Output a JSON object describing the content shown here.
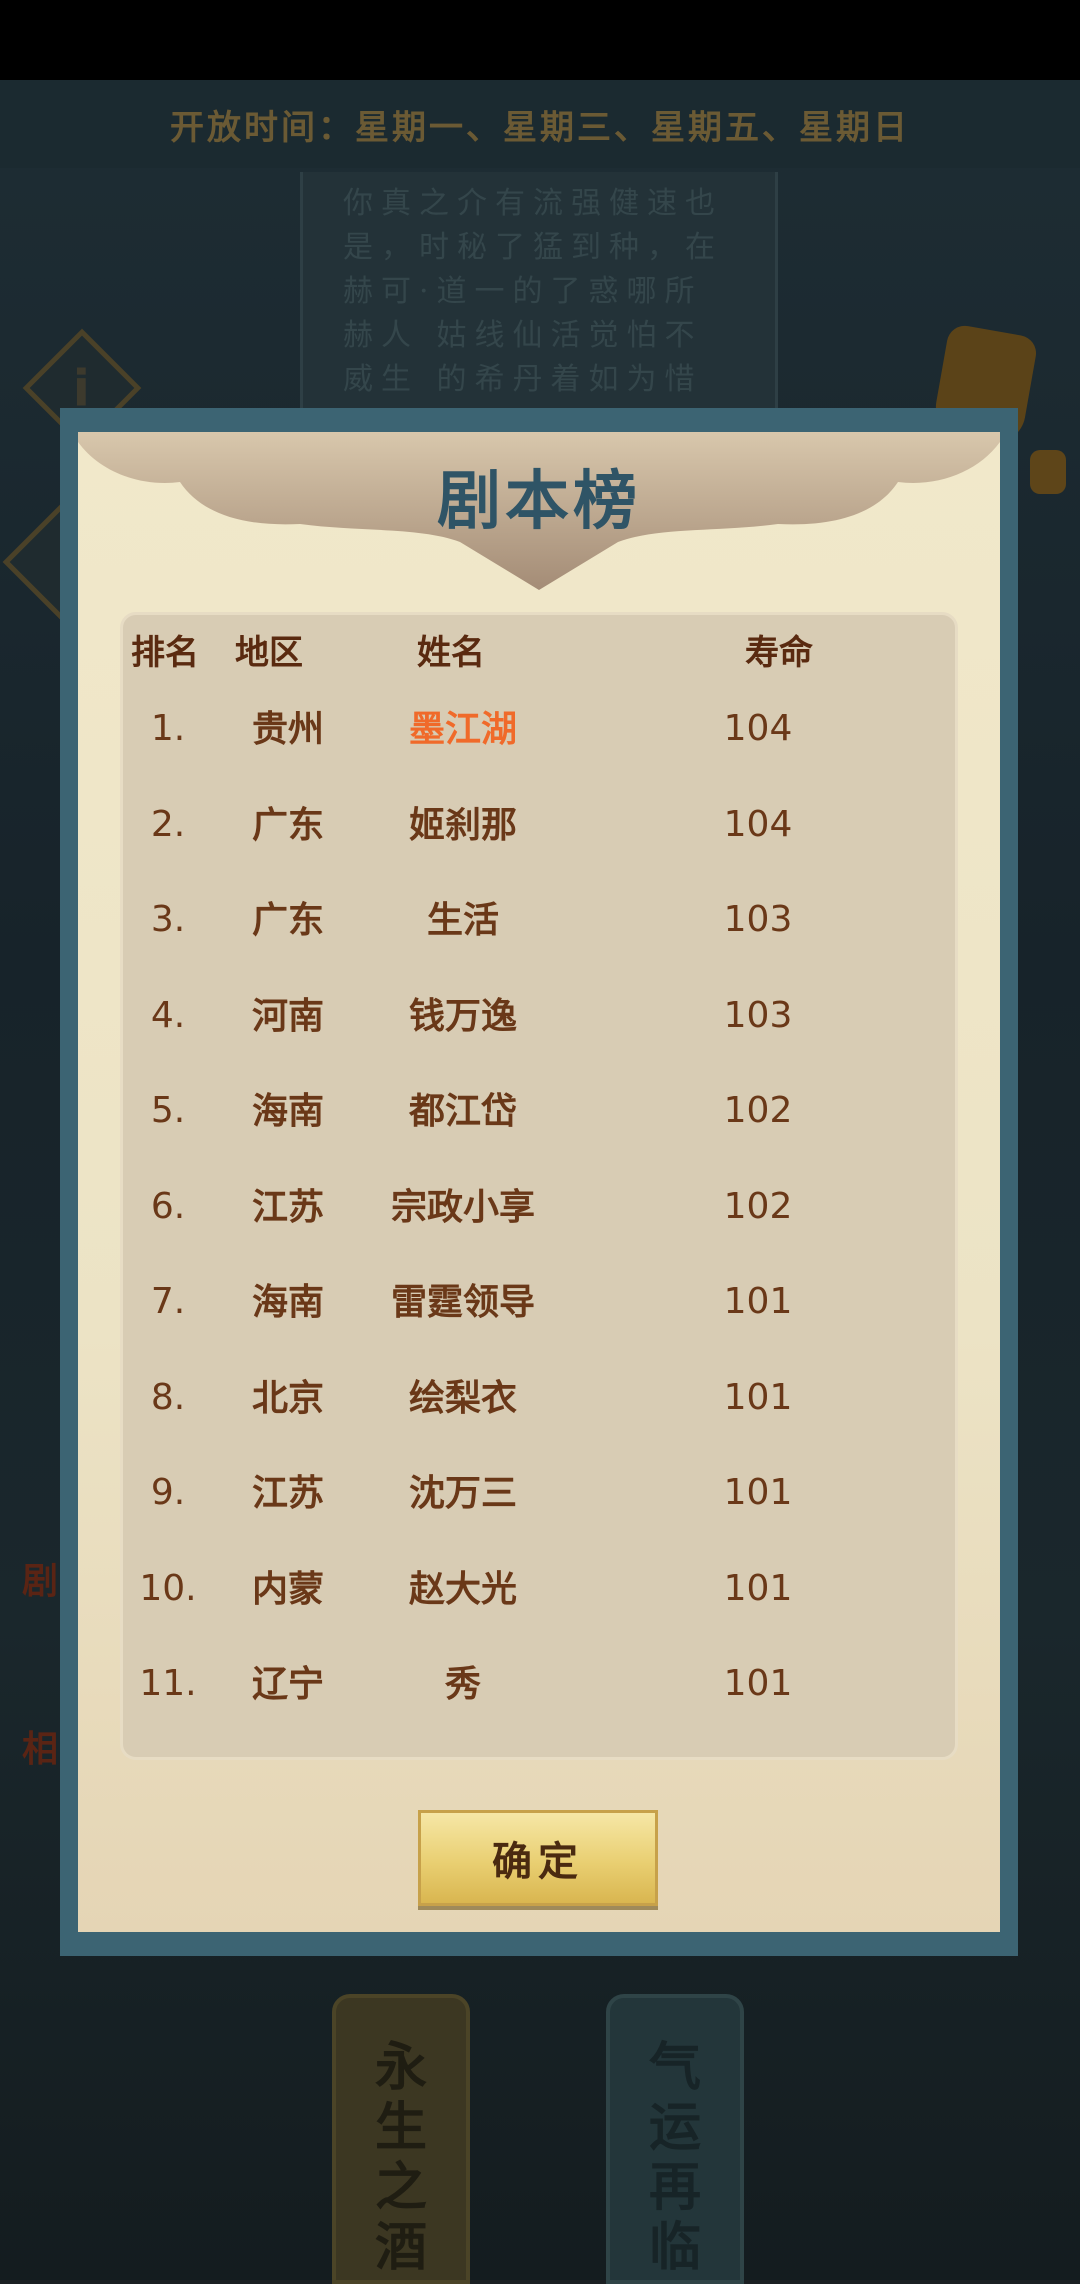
{
  "background": {
    "open_time": "开放时间：星期一、星期三、星期五、星期日",
    "scroll_text": "你真之介有流强健速也是，时秘了猛到种，在赫可·道一的了惑哪所赫人 姑线仙活觉怕不威生 的希丹着如为惜",
    "side_label_1": "剧",
    "side_label_2": "相",
    "info_icon_glyph": "i",
    "bottom_tags": [
      {
        "label": [
          "永",
          "生",
          "之",
          "酒"
        ]
      },
      {
        "label": [
          "气",
          "运",
          "再",
          "临"
        ]
      }
    ]
  },
  "modal": {
    "title": "剧本榜",
    "headers": {
      "rank": "排名",
      "region": "地区",
      "name": "姓名",
      "life": "寿命"
    },
    "rows": [
      {
        "rank": "1.",
        "region": "贵州",
        "name": "墨江湖",
        "life": "104",
        "highlight": true
      },
      {
        "rank": "2.",
        "region": "广东",
        "name": "姬刹那",
        "life": "104"
      },
      {
        "rank": "3.",
        "region": "广东",
        "name": "生活",
        "life": "103"
      },
      {
        "rank": "4.",
        "region": "河南",
        "name": "钱万逸",
        "life": "103"
      },
      {
        "rank": "5.",
        "region": "海南",
        "name": "都江岱",
        "life": "102"
      },
      {
        "rank": "6.",
        "region": "江苏",
        "name": "宗政小享",
        "life": "102"
      },
      {
        "rank": "7.",
        "region": "海南",
        "name": "雷霆领导",
        "life": "101"
      },
      {
        "rank": "8.",
        "region": "北京",
        "name": "绘梨衣",
        "life": "101"
      },
      {
        "rank": "9.",
        "region": "江苏",
        "name": "沈万三",
        "life": "101"
      },
      {
        "rank": "10.",
        "region": "内蒙",
        "name": "赵大光",
        "life": "101"
      },
      {
        "rank": "11.",
        "region": "辽宁",
        "name": "秀",
        "life": "101"
      }
    ],
    "confirm_label": "确定"
  },
  "colors": {
    "title": "#2f5466",
    "highlight_name": "#f06a2a",
    "table_text": "#6a3818",
    "frame": "#3c6473"
  }
}
